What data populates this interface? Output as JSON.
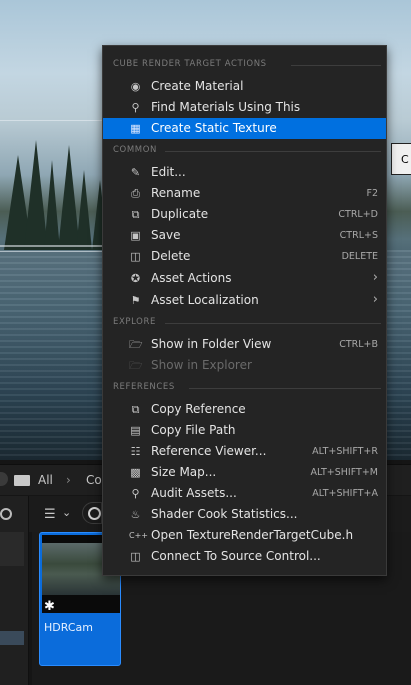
{
  "tooltip_fragment": "C",
  "content_browser": {
    "path_all": "All",
    "path_next": "Co",
    "asset_name": "HDRCam"
  },
  "menu": {
    "sections": {
      "cube": "CUBE RENDER TARGET ACTIONS",
      "common": "COMMON",
      "explore": "EXPLORE",
      "references": "REFERENCES"
    },
    "items": {
      "create_material": {
        "label": "Create Material",
        "icon": "material-icon"
      },
      "find_materials": {
        "label": "Find Materials Using This",
        "icon": "search-icon"
      },
      "create_static_texture": {
        "label": "Create Static Texture",
        "icon": "texture-icon"
      },
      "edit": {
        "label": "Edit...",
        "icon": "pencil-icon"
      },
      "rename": {
        "label": "Rename",
        "shortcut": "F2",
        "icon": "rename-icon"
      },
      "duplicate": {
        "label": "Duplicate",
        "shortcut": "CTRL+D",
        "icon": "duplicate-icon"
      },
      "save": {
        "label": "Save",
        "shortcut": "CTRL+S",
        "icon": "save-icon"
      },
      "delete": {
        "label": "Delete",
        "shortcut": "DELETE",
        "icon": "trash-icon"
      },
      "asset_actions": {
        "label": "Asset Actions",
        "icon": "wrench-icon"
      },
      "asset_localization": {
        "label": "Asset Localization",
        "icon": "flag-icon"
      },
      "show_in_folder_view": {
        "label": "Show in Folder View",
        "shortcut": "CTRL+B",
        "icon": "folder-icon"
      },
      "show_in_explorer": {
        "label": "Show in Explorer",
        "icon": "folder-open-icon"
      },
      "copy_reference": {
        "label": "Copy Reference",
        "icon": "copy-icon"
      },
      "copy_file_path": {
        "label": "Copy File Path",
        "icon": "copy-path-icon"
      },
      "reference_viewer": {
        "label": "Reference Viewer...",
        "shortcut": "ALT+SHIFT+R",
        "icon": "graph-icon"
      },
      "size_map": {
        "label": "Size Map...",
        "shortcut": "ALT+SHIFT+M",
        "icon": "size-map-icon"
      },
      "audit_assets": {
        "label": "Audit Assets...",
        "shortcut": "ALT+SHIFT+A",
        "icon": "audit-icon"
      },
      "shader_cook_statistics": {
        "label": "Shader Cook Statistics...",
        "icon": "pot-icon"
      },
      "open_header": {
        "label": "Open TextureRenderTargetCube.h",
        "icon": "cpp-icon"
      },
      "connect_source_control": {
        "label": "Connect To Source Control...",
        "icon": "source-control-icon"
      }
    }
  },
  "colors": {
    "highlight": "#0070e0",
    "menu_bg": "#242424",
    "tile_selected": "#0b6cdb"
  }
}
